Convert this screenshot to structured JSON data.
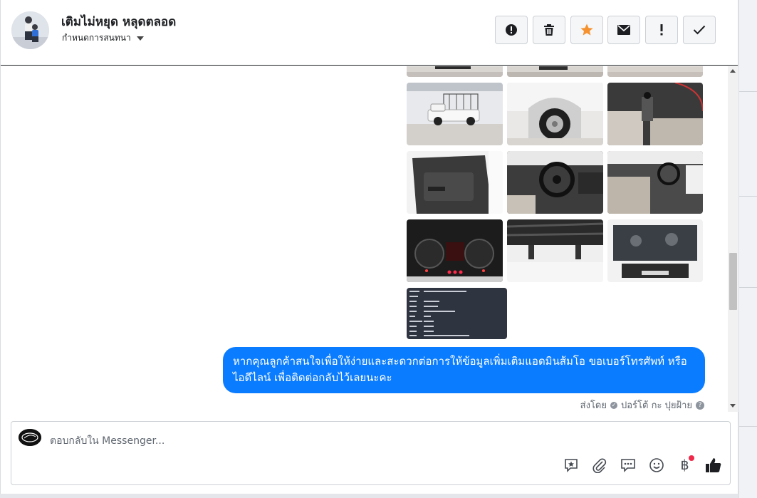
{
  "header": {
    "name": "เติมไม่หยุด หลุดตลอด",
    "subtitle": "กำหนดการสนทนา"
  },
  "toolbar": {
    "buttons": [
      {
        "icon": "alert-circle-icon",
        "glyph": "❗"
      },
      {
        "icon": "trash-icon",
        "glyph": "🗑"
      },
      {
        "icon": "star-icon",
        "glyph": "★"
      },
      {
        "icon": "mail-icon",
        "glyph": "✉"
      },
      {
        "icon": "exclamation-icon",
        "glyph": "!"
      },
      {
        "icon": "check-icon",
        "glyph": "✓"
      }
    ]
  },
  "thread": {
    "photos": [
      {
        "id": "top-1",
        "desc": "cropped truck photo"
      },
      {
        "id": "top-2",
        "desc": "cropped truck photo"
      },
      {
        "id": "top-3",
        "desc": "cropped truck photo"
      },
      {
        "id": "r1c1",
        "desc": "white pickup with rack side view"
      },
      {
        "id": "r1c2",
        "desc": "rear wheel close-up"
      },
      {
        "id": "r1c3",
        "desc": "cabin seats and gear shift"
      },
      {
        "id": "r2c1",
        "desc": "door interior"
      },
      {
        "id": "r2c2",
        "desc": "steering wheel dashboard"
      },
      {
        "id": "r2c3",
        "desc": "interior seats dashboard"
      },
      {
        "id": "r3c1",
        "desc": "instrument cluster"
      },
      {
        "id": "r3c2",
        "desc": "undercarriage tyres"
      },
      {
        "id": "r3c3",
        "desc": "engine bay"
      },
      {
        "id": "r4c1",
        "desc": "spec sheet screenshot"
      }
    ],
    "message": "หากคุณลูกค้าสนใจเพื่อให้ง่ายและสะดวกต่อการให้ข้อมูลเพิ่มเติมแอดมินส้มโอ ขอเบอร์โทรศัพท์ หรือ ไอดีไลน์ เพื่อติดต่อกลับไว้เลยนะคะ",
    "sent_by_label": "ส่งโดย",
    "sent_by_name": "ปอร์โต้ กะ ปุยฝ้าย",
    "help_glyph": "?"
  },
  "composer": {
    "placeholder": "ตอบกลับใน Messenger...",
    "tools": [
      {
        "icon": "saved-reply-icon",
        "glyph": "☆"
      },
      {
        "icon": "attachment-icon",
        "glyph": "📎"
      },
      {
        "icon": "chat-bubble-icon",
        "glyph": "💬"
      },
      {
        "icon": "emoji-icon",
        "glyph": "☺"
      },
      {
        "icon": "baht-payment-icon",
        "glyph": "฿"
      },
      {
        "icon": "thumbs-up-icon",
        "glyph": "👍"
      }
    ]
  },
  "colors": {
    "bubble": "#0a7cff",
    "star": "#f5922f",
    "notification": "#f02849"
  }
}
